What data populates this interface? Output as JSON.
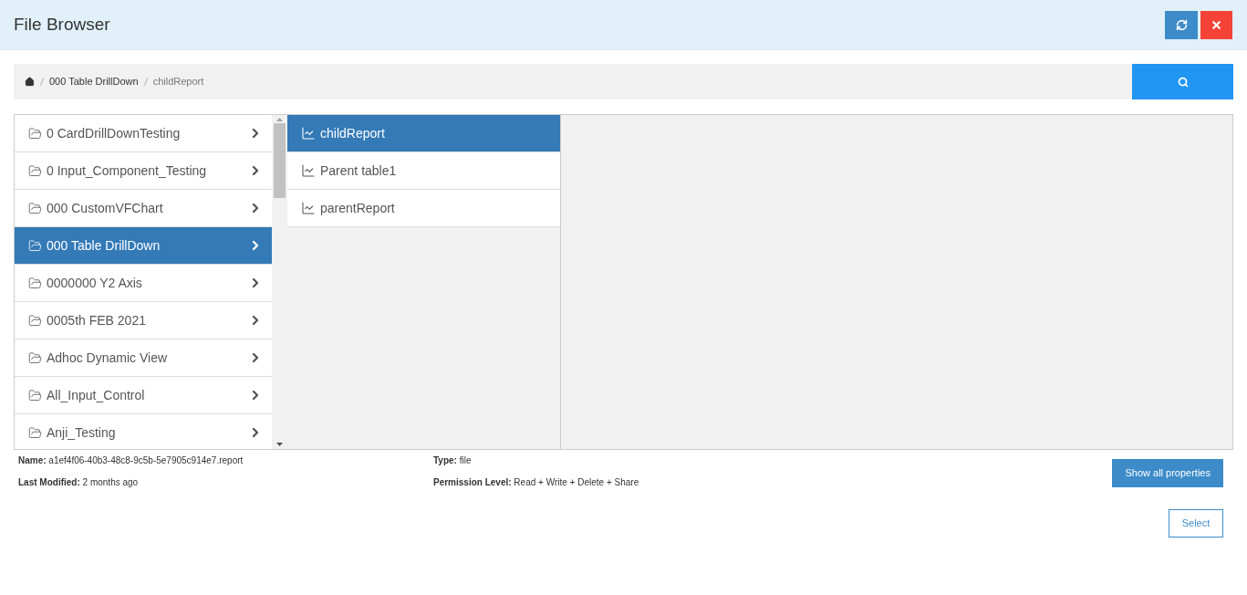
{
  "window": {
    "title": "File Browser"
  },
  "breadcrumb": [
    "000 Table DrillDown",
    "childReport"
  ],
  "folders": [
    {
      "label": "0 CardDrillDownTesting",
      "selected": false
    },
    {
      "label": "0 Input_Component_Testing",
      "selected": false
    },
    {
      "label": "000 CustomVFChart",
      "selected": false
    },
    {
      "label": "000 Table DrillDown",
      "selected": true
    },
    {
      "label": "0000000 Y2 Axis",
      "selected": false
    },
    {
      "label": "0005th FEB 2021",
      "selected": false
    },
    {
      "label": "Adhoc Dynamic View",
      "selected": false
    },
    {
      "label": "All_Input_Control",
      "selected": false
    },
    {
      "label": "Anji_Testing",
      "selected": false
    }
  ],
  "reports": [
    {
      "label": "childReport",
      "selected": true
    },
    {
      "label": "Parent table1",
      "selected": false
    },
    {
      "label": "parentReport",
      "selected": false
    }
  ],
  "details": {
    "name": "**Name:** a1ef4f06-40b3-48c8-9c5b-5e7905c914e7.report",
    "last_modified": "**Last Modified:** 2 months ago",
    "type": "**Type:** file",
    "permission": "**Permission Level:** Read + Write + Delete + Share"
  },
  "buttons": {
    "show_all": "Show all properties",
    "select": "Select"
  }
}
